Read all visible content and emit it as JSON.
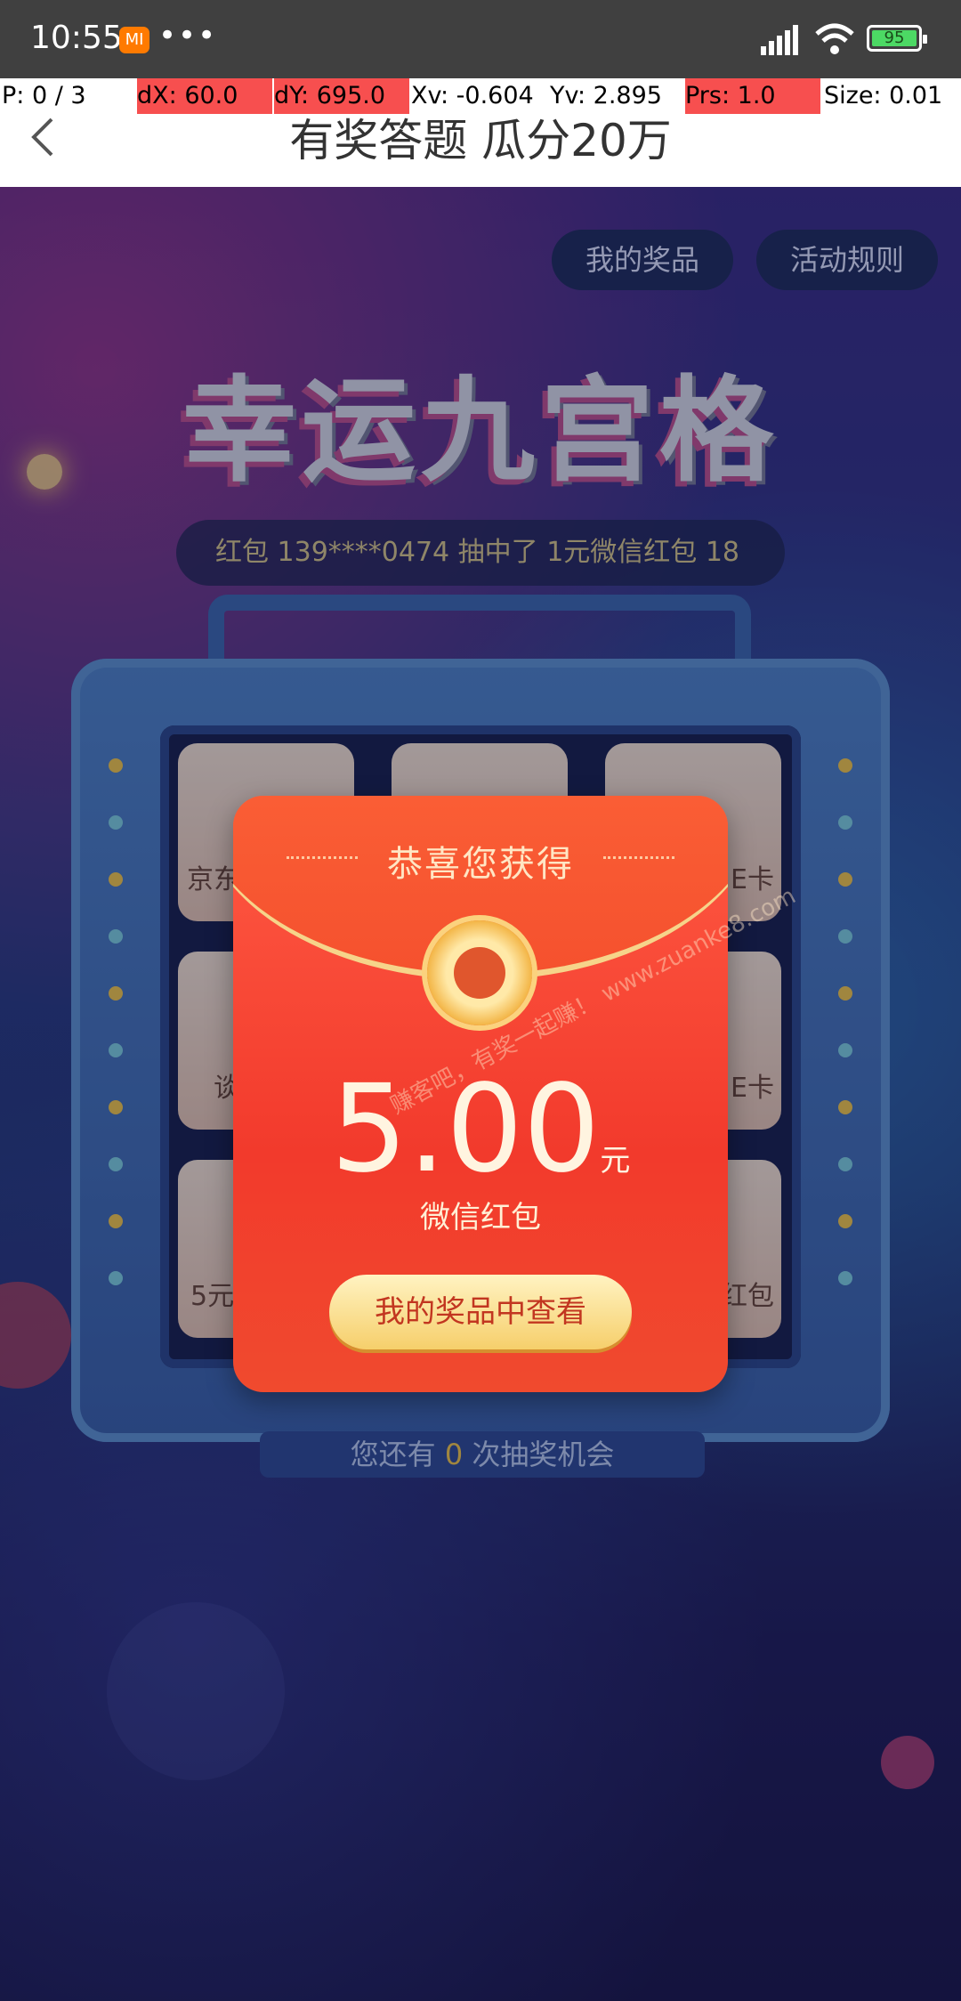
{
  "status_bar": {
    "time": "10:55",
    "mi_badge": "MI",
    "dots": "•••",
    "battery": "95"
  },
  "debug_overlay": {
    "p": "P: 0 / 3",
    "dx": "dX: 60.0",
    "dy": "dY: 695.0",
    "xv": "Xv: -0.604",
    "yv": "Yv: 2.895",
    "prs": "Prs: 1.0",
    "size": "Size: 0.01"
  },
  "header": {
    "title": "有奖答题 瓜分20万"
  },
  "top_buttons": {
    "my_prizes": "我的奖品",
    "rules": "活动规则"
  },
  "game": {
    "title": "幸运九宫格",
    "ticker": "红包  139****0474 抽中了 1元微信红包  18",
    "cells": [
      "京东",
      "",
      "E卡",
      "谈",
      "",
      "E卡",
      "5元",
      "",
      "红包"
    ],
    "chances_prefix": "您还有 ",
    "chances_count": "0",
    "chances_suffix": " 次抽奖机会"
  },
  "packet": {
    "title": "恭喜您获得",
    "amount": "5.00",
    "unit": "元",
    "subtitle": "微信红包",
    "button": "我的奖品中查看",
    "watermark": "赚客吧，有奖一起赚！ www.zuanke8.com"
  },
  "colors": {
    "status_bar": "#404040",
    "packet_red": "#f23a2c",
    "button_gold": "#f6cf6b",
    "machine_blue": "#4f86c9"
  }
}
